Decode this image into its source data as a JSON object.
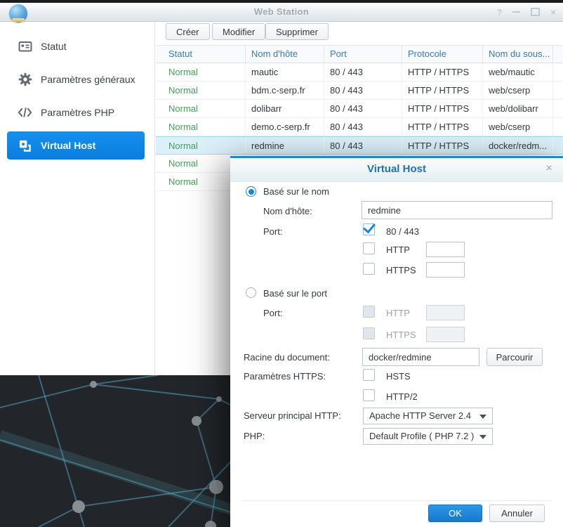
{
  "window": {
    "title": "Web Station",
    "controls": {
      "help": "?",
      "close": "×"
    }
  },
  "sidebar": {
    "items": [
      {
        "label": "Statut",
        "icon": "status-card-icon",
        "selected": false
      },
      {
        "label": "Paramètres généraux",
        "icon": "gear-icon",
        "selected": false
      },
      {
        "label": "Paramètres PHP",
        "icon": "code-icon",
        "selected": false
      },
      {
        "label": "Virtual Host",
        "icon": "virtual-host-icon",
        "selected": true
      }
    ]
  },
  "toolbar": {
    "create_label": "Créer",
    "edit_label": "Modifier",
    "delete_label": "Supprimer"
  },
  "table": {
    "columns": [
      "Statut",
      "Nom d'hôte",
      "Port",
      "Protocole",
      "Nom du sous..."
    ],
    "rows": [
      {
        "status": "Normal",
        "host": "mautic",
        "port": "80 / 443",
        "protocol": "HTTP / HTTPS",
        "folder": "web/mautic",
        "selected": false
      },
      {
        "status": "Normal",
        "host": "bdm.c-serp.fr",
        "port": "80 / 443",
        "protocol": "HTTP / HTTPS",
        "folder": "web/cserp",
        "selected": false
      },
      {
        "status": "Normal",
        "host": "dolibarr",
        "port": "80 / 443",
        "protocol": "HTTP / HTTPS",
        "folder": "web/dolibarr",
        "selected": false
      },
      {
        "status": "Normal",
        "host": "demo.c-serp.fr",
        "port": "80 / 443",
        "protocol": "HTTP / HTTPS",
        "folder": "web/cserp",
        "selected": false
      },
      {
        "status": "Normal",
        "host": "redmine",
        "port": "80 / 443",
        "protocol": "HTTP / HTTPS",
        "folder": "docker/redm...",
        "selected": true
      },
      {
        "status": "Normal",
        "host": "",
        "port": "",
        "protocol": "",
        "folder": "",
        "selected": false
      },
      {
        "status": "Normal",
        "host": "",
        "port": "",
        "protocol": "",
        "folder": "",
        "selected": false
      }
    ]
  },
  "dialog": {
    "title": "Virtual Host",
    "close_glyph": "×",
    "name_based": {
      "radio_label": "Basé sur le nom",
      "selected": true,
      "host_label": "Nom d'hôte:",
      "host_value": "redmine",
      "port_label": "Port:",
      "default_port": {
        "label": "80 / 443",
        "checked": true
      },
      "http": {
        "label": "HTTP",
        "checked": false,
        "value": ""
      },
      "https": {
        "label": "HTTPS",
        "checked": false,
        "value": ""
      }
    },
    "port_based": {
      "radio_label": "Basé sur le port",
      "selected": false,
      "port_label": "Port:",
      "http": {
        "label": "HTTP",
        "checked": false,
        "value": "",
        "disabled": true
      },
      "https": {
        "label": "HTTPS",
        "checked": false,
        "value": "",
        "disabled": true
      }
    },
    "document_root": {
      "label": "Racine du document:",
      "value": "docker/redmine",
      "browse_label": "Parcourir"
    },
    "https_settings": {
      "label": "Paramètres HTTPS:",
      "hsts": {
        "label": "HSTS",
        "checked": false
      },
      "http2": {
        "label": "HTTP/2",
        "checked": false
      }
    },
    "backend": {
      "label": "Serveur principal HTTP:",
      "value": "Apache HTTP Server 2.4"
    },
    "php": {
      "label": "PHP:",
      "value": "Default Profile ( PHP 7.2 )"
    },
    "ok_label": "OK",
    "cancel_label": "Annuler"
  },
  "colors": {
    "accent_blue": "#0d84e8",
    "status_green": "#45a05a",
    "table_header_blue": "#3a7ab5",
    "dialog_title_blue": "#2272ab",
    "selection_bg": "#dcf0fb",
    "wallpaper": "#22262a"
  }
}
